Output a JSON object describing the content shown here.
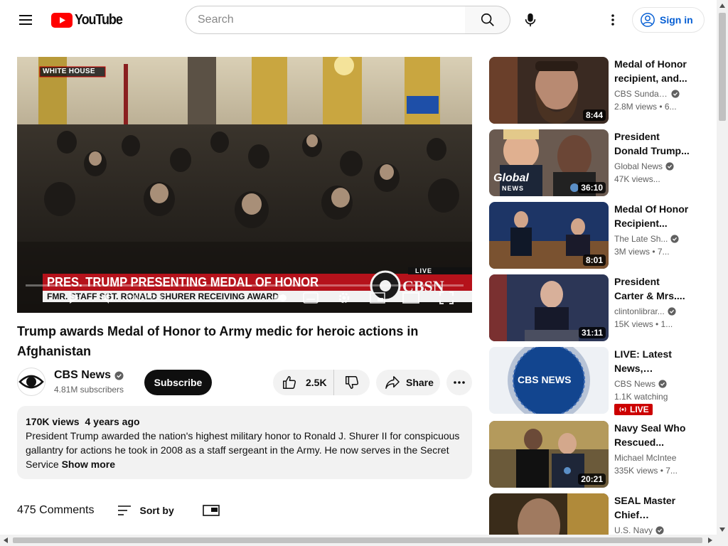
{
  "masthead": {
    "logo_text": "YouTube",
    "search_placeholder": "Search",
    "signin_label": "Sign in"
  },
  "player": {
    "corner_bug": "WHITE HOUSE",
    "chyron_line1": "PRES. TRUMP PRESENTING MEDAL OF HONOR",
    "chyron_line2": "FMR. STAFF SGT. RONALD SHURER RECEIVING AWARD",
    "live_tag": "LIVE",
    "network_logo": "CBSN",
    "scrubber_time": "0:00 / 2:47"
  },
  "video": {
    "title": "Trump awards Medal of Honor to Army medic for heroic actions in Afghanistan",
    "channel_name": "CBS News",
    "subscribers": "4.81M subscribers",
    "subscribe_label": "Subscribe",
    "likes": "2.5K",
    "share_label": "Share",
    "views": "170K views",
    "age": "4 years ago",
    "description": "President Trump awarded the nation's highest military honor to Ronald J. Shurer II for conspicuous gallantry for actions he took in 2008 as a staff sergeant in the Army. He now serves in the Secret Service",
    "show_more": "Show more"
  },
  "comments": {
    "count": "475 Comments",
    "sort_label": "Sort by"
  },
  "recommendations": [
    {
      "title": "Medal of Honor recipient, and...",
      "channel": "CBS Sunday...",
      "meta": "2.8M views  • 6...",
      "duration": "8:44",
      "verified": true
    },
    {
      "title": "President Donald Trump...",
      "channel": "Global News",
      "meta": "47K views...",
      "duration": "36:10",
      "verified": true,
      "thumb_text": "Global",
      "thumb_subtext": "NEWS"
    },
    {
      "title": "Medal Of Honor Recipient...",
      "channel": "The Late Sh...",
      "meta": "3M views  • 7...",
      "duration": "8:01",
      "verified": true
    },
    {
      "title": "President Carter & Mrs....",
      "channel": "clintonlibrar...",
      "meta": "15K views  • 1...",
      "duration": "31:11",
      "verified": true
    },
    {
      "title": "LIVE: Latest News, Breakin...",
      "channel": "CBS News",
      "meta": "1.1K watching",
      "duration": "",
      "verified": true,
      "live_label": "LIVE",
      "thumb_text": "CBS NEWS"
    },
    {
      "title": "Navy Seal Who Rescued...",
      "channel": "Michael McIntee",
      "meta": "335K views  • 7...",
      "duration": "20:21",
      "verified": false
    },
    {
      "title": "SEAL Master Chief Recount...",
      "channel": "U.S. Navy",
      "meta": "",
      "duration": "",
      "verified": true
    }
  ],
  "colors": {
    "brand_red": "#ff0000",
    "link_blue": "#065fd4",
    "chip_bg": "#f2f2f2",
    "live_red": "#cc0000"
  }
}
